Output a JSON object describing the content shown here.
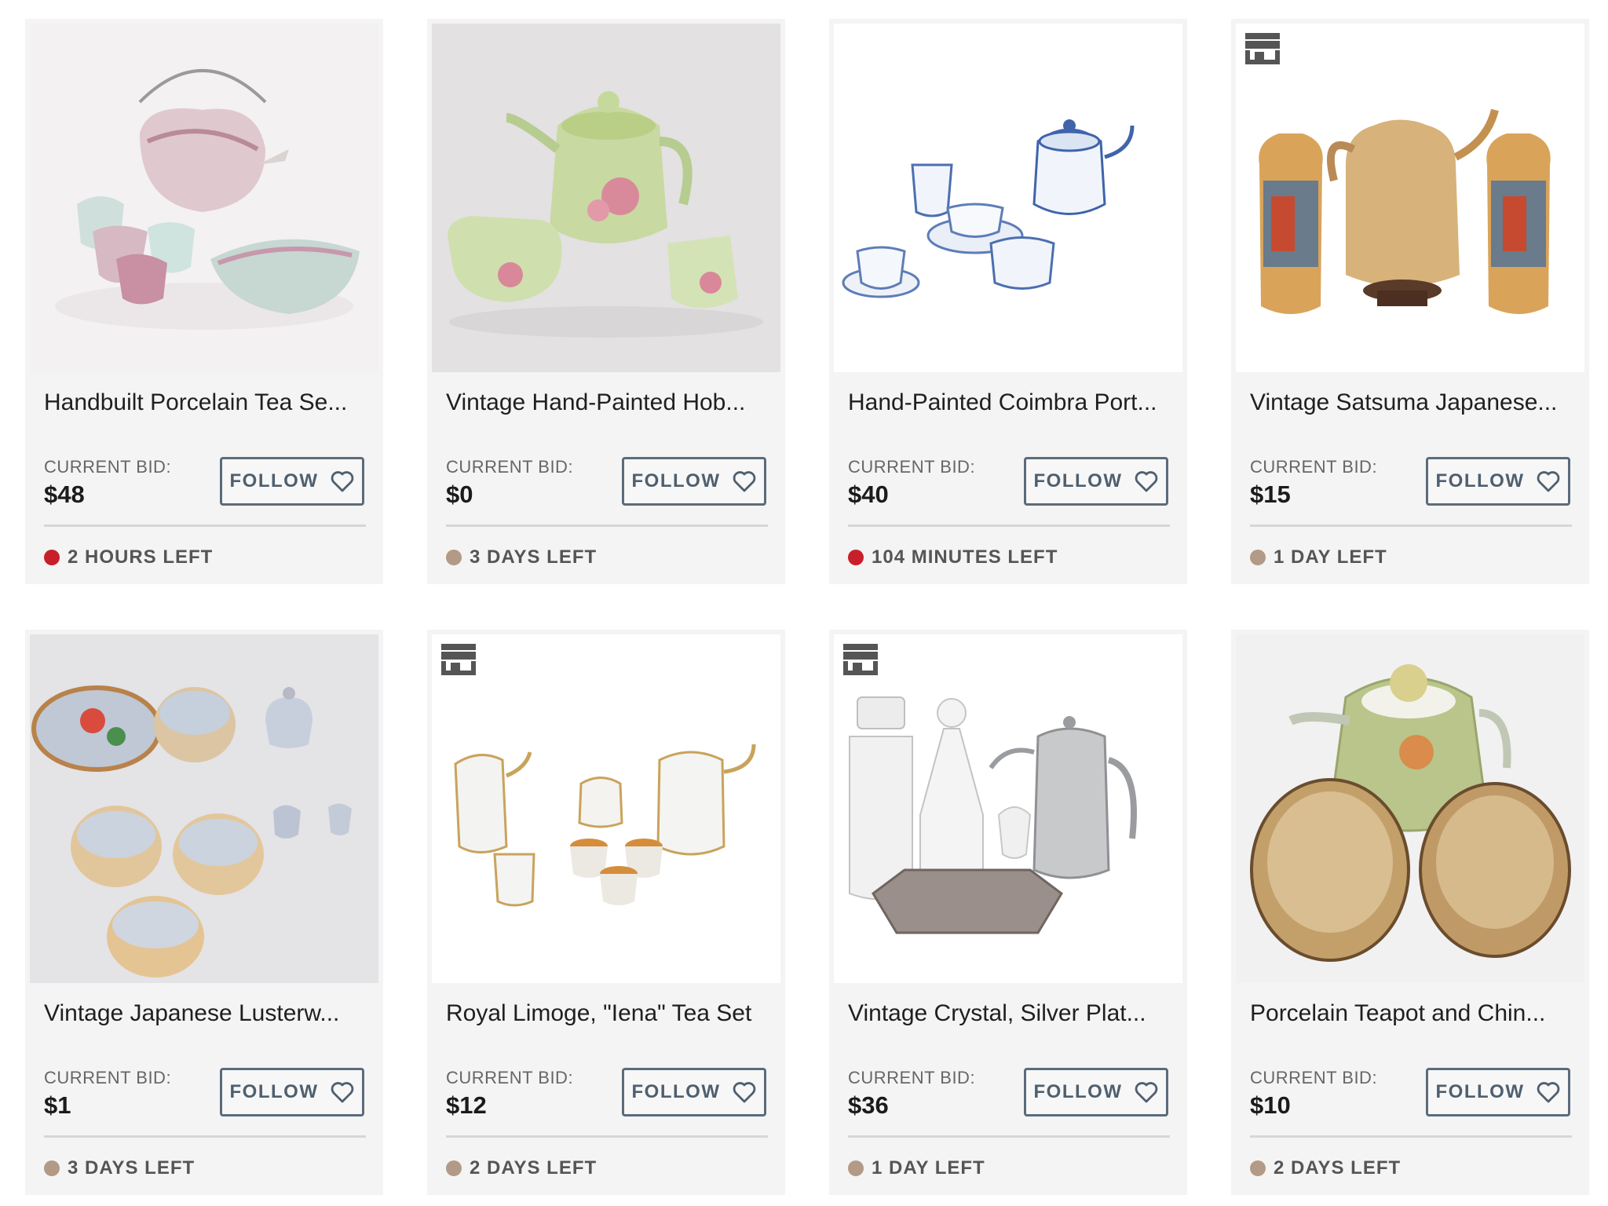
{
  "listing": {
    "bid_label": "CURRENT BID:",
    "follow_label": "FOLLOW",
    "items": [
      {
        "title": "Handbuilt Porcelain Tea Se...",
        "bid": "$48",
        "time_left": "2 HOURS LEFT",
        "urgency": "urgent",
        "store_badge": false,
        "image": "porcelain-tea-set"
      },
      {
        "title": "Vintage Hand-Painted Hob...",
        "bid": "$0",
        "time_left": "3 DAYS LEFT",
        "urgency": "normal",
        "store_badge": false,
        "image": "green-rose-tea-set"
      },
      {
        "title": "Hand-Painted Coimbra Port...",
        "bid": "$40",
        "time_left": "104 MINUTES LEFT",
        "urgency": "urgent",
        "store_badge": false,
        "image": "blue-white-tea-set"
      },
      {
        "title": "Vintage Satsuma Japanese...",
        "bid": "$15",
        "time_left": "1 DAY LEFT",
        "urgency": "normal",
        "store_badge": true,
        "image": "satsuma-vases"
      },
      {
        "title": "Vintage Japanese Lusterw...",
        "bid": "$1",
        "time_left": "3 DAYS LEFT",
        "urgency": "normal",
        "store_badge": false,
        "image": "lusterware-set"
      },
      {
        "title": "Royal Limoge, \"Iena\" Tea Set",
        "bid": "$12",
        "time_left": "2 DAYS LEFT",
        "urgency": "normal",
        "store_badge": true,
        "image": "limoge-tea-set"
      },
      {
        "title": "Vintage Crystal, Silver Plat...",
        "bid": "$36",
        "time_left": "1 DAY LEFT",
        "urgency": "normal",
        "store_badge": true,
        "image": "crystal-silver-set"
      },
      {
        "title": "Porcelain Teapot and Chin...",
        "bid": "$10",
        "time_left": "2 DAYS LEFT",
        "urgency": "normal",
        "store_badge": false,
        "image": "teapot-eggs"
      }
    ]
  },
  "colors": {
    "urgent_dot": "#c8202a",
    "normal_dot": "#b39a86",
    "follow_border": "#5b6b7b",
    "card_bg": "#f4f4f4"
  }
}
